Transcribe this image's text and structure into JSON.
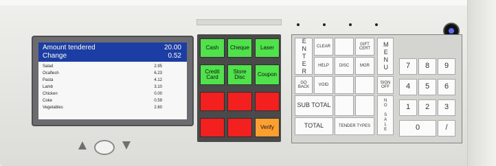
{
  "screen": {
    "header_rows": [
      {
        "label": "Amount tendered",
        "value": "20.00"
      },
      {
        "label": "Change",
        "value": "0.52"
      }
    ],
    "items": [
      {
        "label": "Salad",
        "value": "2.95"
      },
      {
        "label": "Ocaflesh",
        "value": "6.23"
      },
      {
        "label": "Pasta",
        "value": "4.12"
      },
      {
        "label": "Lamb",
        "value": "3.10"
      },
      {
        "label": "Chicken",
        "value": "0.00"
      },
      {
        "label": "Coke",
        "value": "0.59"
      },
      {
        "label": "Vegetables",
        "value": "2.60"
      }
    ]
  },
  "left_keypad": {
    "keys": [
      "Cash",
      "Cheque",
      "Laser",
      "Credit Card",
      "Store Disc",
      "Coupon",
      "",
      "",
      "",
      "",
      "",
      "Verify"
    ]
  },
  "right_keypad": {
    "enter": "ENTER",
    "clear": "CLEAR",
    "unlabeled_top": "",
    "gift_cert": "GIFT CERT",
    "menu": "MENU",
    "help": "HELP",
    "disc": "DISC",
    "mgr": "MGR",
    "go_back": "GO BACK",
    "void": "VOID",
    "sign_off": "SIGN OFF",
    "sub_total": "SUB TOTAL",
    "no_sale": "NO SALE",
    "total": "TOTAL",
    "tender_types": "TENDER TYPES",
    "num": {
      "k7": "7",
      "k8": "8",
      "k9": "9",
      "k4": "4",
      "k5": "5",
      "k6": "6",
      "k1": "1",
      "k2": "2",
      "k3": "3",
      "k0": "0",
      "slash": "/"
    }
  },
  "colors": {
    "display_header": "#1c3ea4",
    "green": "#4fe24a",
    "red": "#f41f1f",
    "orange": "#ff9f2f"
  },
  "icons": {
    "nav_left": "triangle-up-icon",
    "nav_center": "circle-button-icon",
    "nav_right": "triangle-down-icon",
    "status_light": "indicator-light-icon"
  }
}
